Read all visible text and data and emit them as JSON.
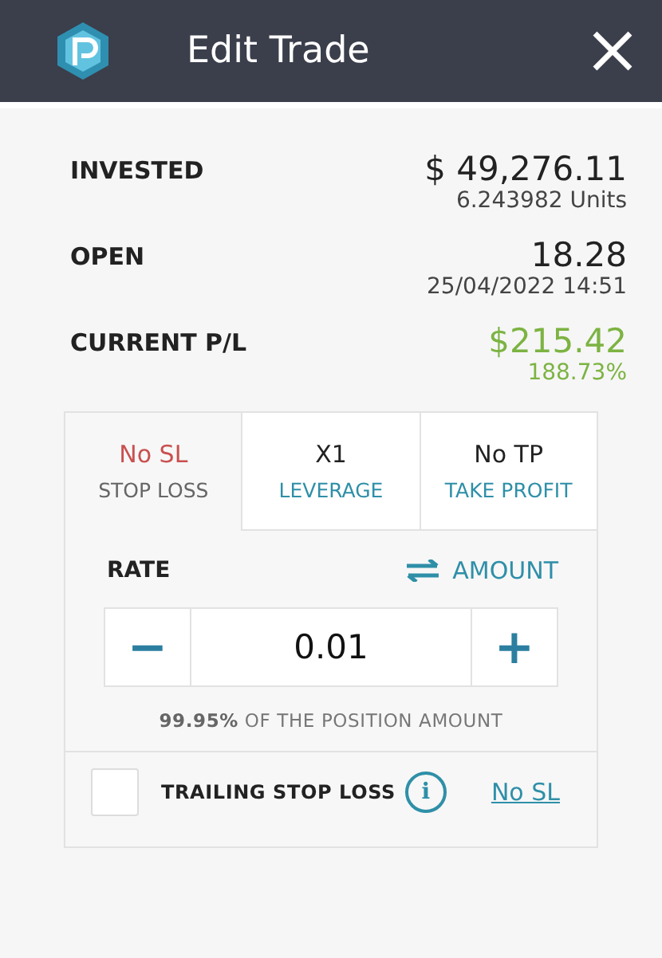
{
  "window": {
    "title": "Edit Trade"
  },
  "details": [
    {
      "label": "INVESTED",
      "value": "$ 49,276.11",
      "sub": "6.243982 Units",
      "kind": "plain"
    },
    {
      "label": "OPEN",
      "value": "18.28",
      "sub": "25/04/2022 14:51",
      "kind": "plain"
    },
    {
      "label": "CURRENT P/L",
      "value": "$215.42",
      "sub": "188.73%",
      "kind": "profit"
    }
  ],
  "tabs": [
    {
      "value": "No SL",
      "label": "STOP LOSS",
      "selected": true
    },
    {
      "value": "X1",
      "label": "LEVERAGE",
      "selected": false
    },
    {
      "value": "No TP",
      "label": "TAKE PROFIT",
      "selected": false
    }
  ],
  "rate": {
    "label": "RATE",
    "switch": "AMOUNT",
    "minus": "−",
    "value": "0.01",
    "plus": "+",
    "note_value": "99.95%",
    "note": "OF THE POSITION AMOUNT"
  },
  "trailing": {
    "checked": false,
    "label": "TRAILING STOP LOSS",
    "info": "i",
    "link": "No SL"
  }
}
